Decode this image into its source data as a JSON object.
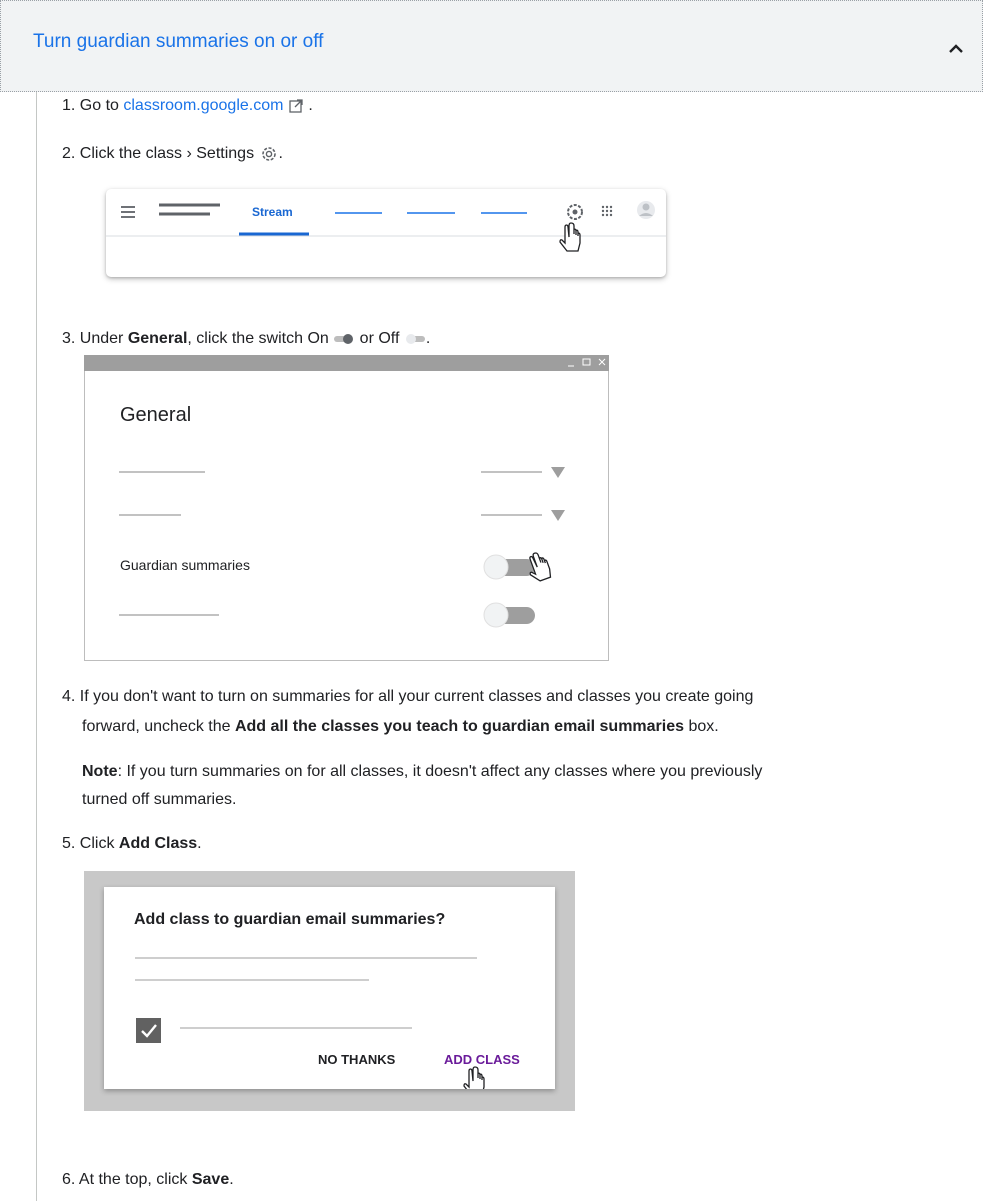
{
  "section": {
    "title": "Turn guardian summaries on or off"
  },
  "steps": {
    "step1": {
      "prefix": "1. Go to ",
      "link": "classroom.google.com",
      "suffix": " ."
    },
    "step2": {
      "prefix": "2. Click the class ",
      "sep": "›",
      "text": " Settings ",
      "end": "."
    },
    "step3": {
      "prefix": "3. Under ",
      "bold": "General",
      "mid": ", click the switch On ",
      "or": " or Off ",
      "end": "."
    },
    "step4": {
      "line1": "4. If you don't want to turn on summaries for all your current classes and classes you create going",
      "line2_prefix": "forward, uncheck the ",
      "line2_bold": "Add all the classes you teach to guardian email summaries",
      "line2_suffix": " box."
    },
    "note": {
      "label": "Note",
      "line1": ": If you turn summaries on for all classes, it doesn't affect any classes where you previously",
      "line2": "turned off summaries."
    },
    "step5": {
      "prefix": "5. Click ",
      "bold": "Add Class",
      "end": "."
    },
    "step6": {
      "prefix": "6. At the top, click ",
      "bold": "Save",
      "end": "."
    }
  },
  "illustration_stream": {
    "tab_label": "Stream"
  },
  "illustration_general": {
    "heading": "General",
    "row_label": "Guardian summaries"
  },
  "illustration_dialog": {
    "title": "Add class to guardian email summaries?",
    "no_thanks": "NO THANKS",
    "add_class": "ADD CLASS"
  },
  "colors": {
    "link": "#1a73e8",
    "accent_purple": "#6a1b9a",
    "header_bg": "#f1f3f4"
  }
}
